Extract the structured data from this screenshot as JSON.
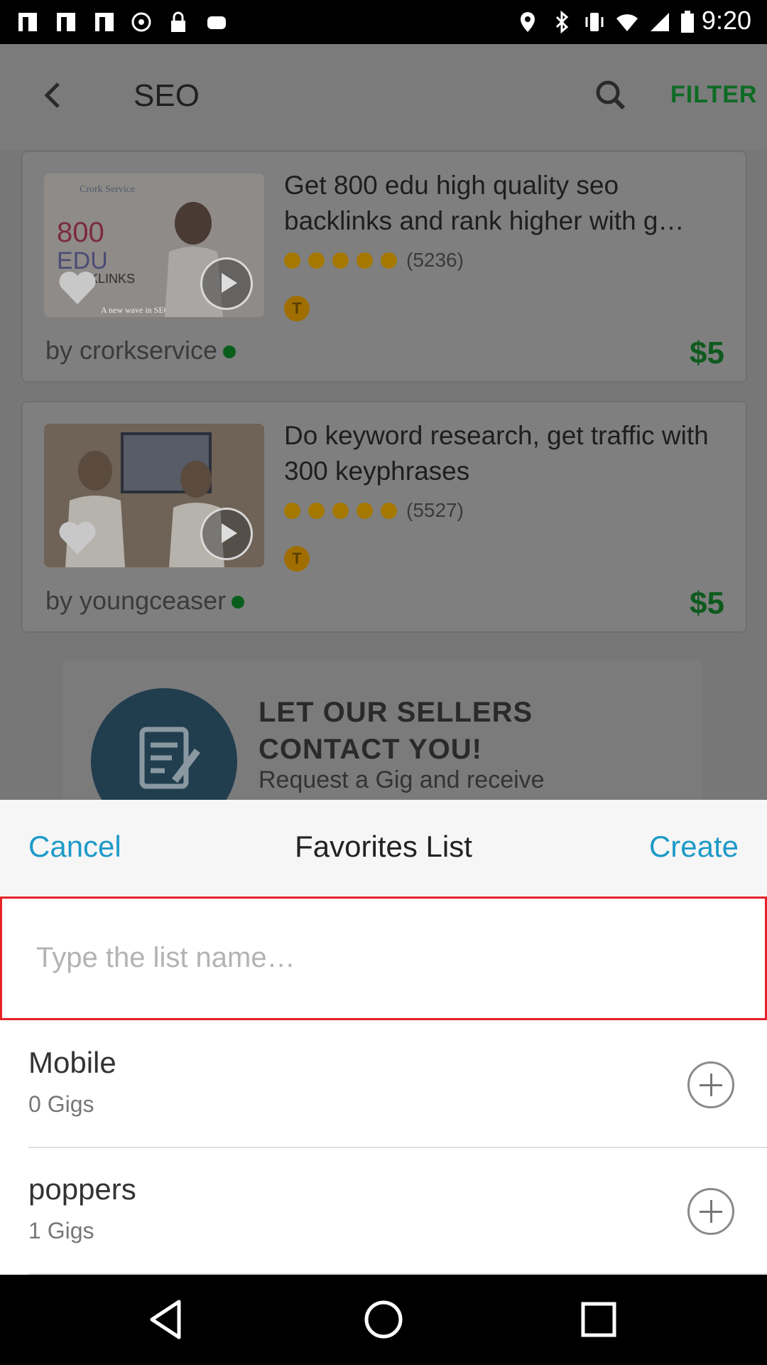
{
  "status_bar": {
    "time": "9:20"
  },
  "header": {
    "title": "SEO",
    "filter_label": "FILTER"
  },
  "gigs": [
    {
      "title": "Get 800 edu high quality seo backlinks and rank higher with g…",
      "rating_count": "(5236)",
      "badge": "T",
      "seller": "by crorkservice",
      "price": "$5",
      "thumb_text": [
        "Crork Service",
        "800",
        "EDU",
        "KLINKS",
        "A new wave in SEO are"
      ]
    },
    {
      "title": "Do keyword research, get traffic with 300 keyphrases",
      "rating_count": "(5527)",
      "badge": "T",
      "seller": "by youngceaser",
      "price": "$5"
    }
  ],
  "promo": {
    "headline": "LET OUR SELLERS CONTACT YOU!",
    "subtext": "Request a Gig and receive"
  },
  "sheet": {
    "cancel_label": "Cancel",
    "title": "Favorites List",
    "create_label": "Create",
    "input_placeholder": "Type the list name…",
    "lists": [
      {
        "name": "Mobile",
        "count": "0 Gigs"
      },
      {
        "name": "poppers",
        "count": "1 Gigs"
      }
    ]
  },
  "colors": {
    "accent": "#1d9ac8",
    "error_border": "#e52227",
    "price_green": "#0e5a1e",
    "star": "#a57800"
  }
}
